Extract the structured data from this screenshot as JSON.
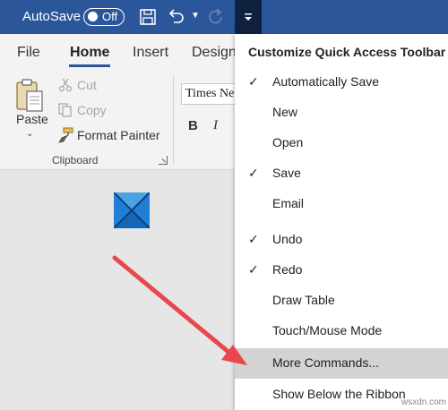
{
  "titlebar": {
    "autosave_label": "AutoSave",
    "autosave_toggle": "Off"
  },
  "tabs": [
    "File",
    "Home",
    "Insert",
    "Design"
  ],
  "ribbon": {
    "paste_label": "Paste",
    "cut_label": "Cut",
    "copy_label": "Copy",
    "format_painter_label": "Format Painter",
    "clipboard_group_label": "Clipboard",
    "font_name": "Times New Roman",
    "bold_label": "B",
    "italic_label": "I"
  },
  "menu": {
    "title": "Customize Quick Access Toolbar",
    "items": [
      {
        "label": "Automatically Save",
        "checked": true
      },
      {
        "label": "New",
        "checked": false
      },
      {
        "label": "Open",
        "checked": false
      },
      {
        "label": "Save",
        "checked": true
      },
      {
        "label": "Email",
        "checked": false
      },
      {
        "label": "Undo",
        "checked": true
      },
      {
        "label": "Redo",
        "checked": true
      },
      {
        "label": "Draw Table",
        "checked": false
      },
      {
        "label": "Touch/Mouse Mode",
        "checked": false
      },
      {
        "label": "More Commands...",
        "checked": false,
        "highlighted": true
      },
      {
        "label": "Show Below the Ribbon",
        "checked": false
      }
    ],
    "check_glyph": "✓"
  },
  "watermark": "wsxdn.com",
  "colors": {
    "titlebar": "#2b579a",
    "customize_button": "#10203f",
    "arrow": "#e8474c",
    "highlight": "#d3d3d3"
  },
  "icons": {
    "save": "floppy-disk-icon",
    "undo": "undo-icon",
    "redo": "redo-icon",
    "customize": "customize-dropdown-icon",
    "paste": "clipboard-icon",
    "cut": "scissors-icon",
    "copy": "copy-icon",
    "format_painter": "paintbrush-icon"
  }
}
